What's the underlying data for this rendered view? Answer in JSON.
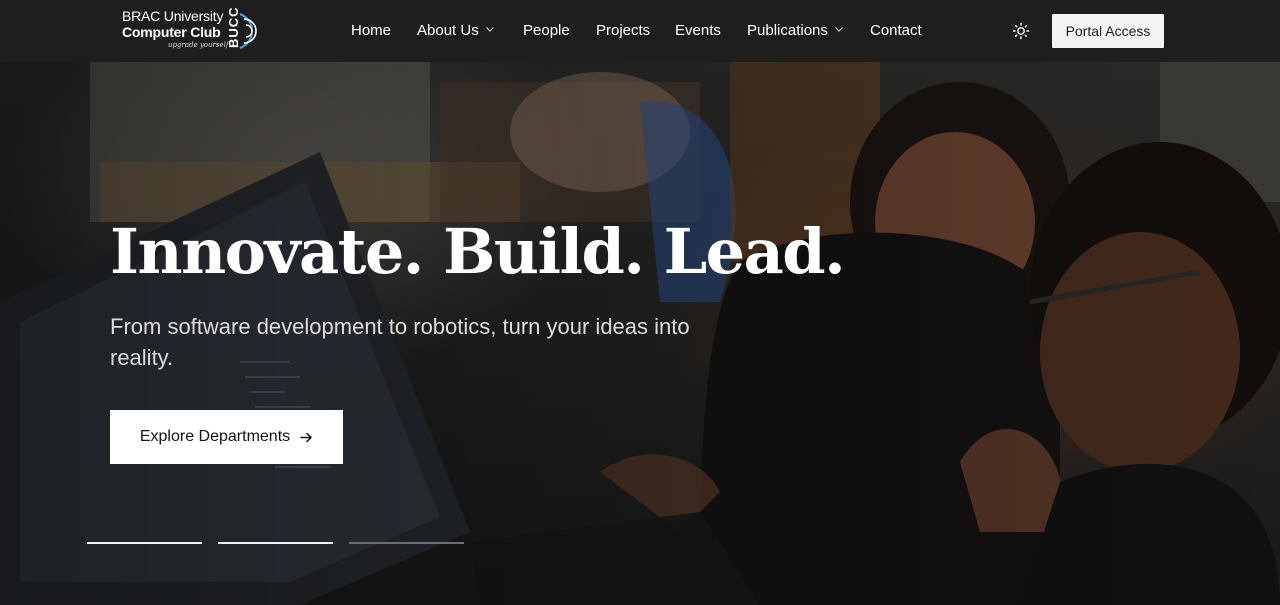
{
  "brand": {
    "line1": "BRAC University",
    "line2": "Computer Club",
    "tagline": "upgrade yourself",
    "mark": "BUCC"
  },
  "nav": {
    "items": [
      {
        "label": "Home",
        "has_dropdown": false
      },
      {
        "label": "About Us",
        "has_dropdown": true
      },
      {
        "label": "People",
        "has_dropdown": false
      },
      {
        "label": "Projects",
        "has_dropdown": false
      },
      {
        "label": "Events",
        "has_dropdown": false
      },
      {
        "label": "Publications",
        "has_dropdown": true
      },
      {
        "label": "Contact",
        "has_dropdown": false
      }
    ],
    "theme_icon": "sun-icon",
    "portal_label": "Portal Access"
  },
  "hero": {
    "title": "Innovate. Build. Lead.",
    "subtitle": "From software development to robotics, turn your ideas into reality.",
    "cta_label": "Explore Departments",
    "cta_icon": "arrow-right-icon",
    "slides_total": 3,
    "active_slides": [
      1,
      2
    ]
  },
  "colors": {
    "nav_bg": "#1e1e1e",
    "button_bg": "#f4f4f2",
    "text": "#ffffff"
  }
}
